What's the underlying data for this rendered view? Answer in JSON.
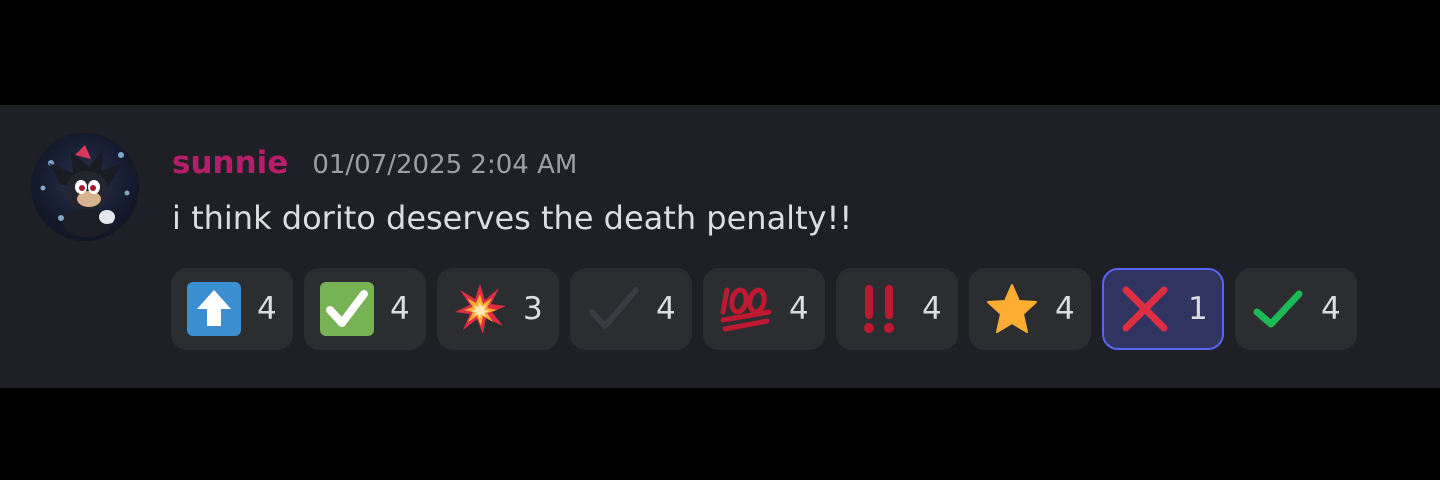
{
  "message": {
    "username": "sunnie",
    "timestamp": "01/07/2025 2:04 AM",
    "content": "i think dorito deserves the death penalty!!",
    "username_color": "#b51e6b"
  },
  "reactions": [
    {
      "emoji": "up-arrow-icon",
      "count": "4",
      "selected": false
    },
    {
      "emoji": "check-mark-button-icon",
      "count": "4",
      "selected": false
    },
    {
      "emoji": "collision-icon",
      "count": "3",
      "selected": false
    },
    {
      "emoji": "dark-check-icon",
      "count": "4",
      "selected": false
    },
    {
      "emoji": "hundred-points-icon",
      "count": "4",
      "selected": false
    },
    {
      "emoji": "double-exclamation-icon",
      "count": "4",
      "selected": false
    },
    {
      "emoji": "star-icon",
      "count": "4",
      "selected": false
    },
    {
      "emoji": "cross-mark-icon",
      "count": "1",
      "selected": true
    },
    {
      "emoji": "green-check-icon",
      "count": "4",
      "selected": false
    }
  ],
  "colors": {
    "background": "#1f2025",
    "reaction_bg": "#2b2d31",
    "selected_border": "#5865f2"
  }
}
